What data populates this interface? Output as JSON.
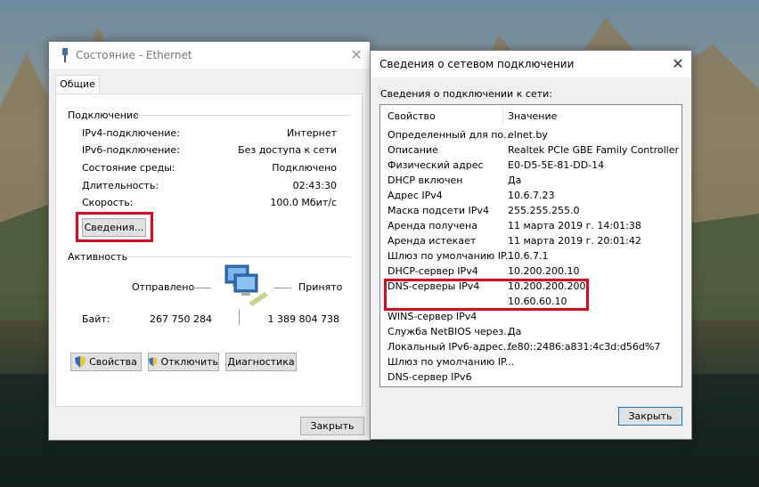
{
  "win1": {
    "title": "Состояние - Ethernet",
    "tab": "Общие",
    "connection": {
      "heading": "Подключение",
      "rows": [
        {
          "label": "IPv4-подключение:",
          "value": "Интернет"
        },
        {
          "label": "IPv6-подключение:",
          "value": "Без доступа к сети"
        },
        {
          "label": "Состояние среды:",
          "value": "Подключено"
        },
        {
          "label": "Длительность:",
          "value": "02:43:30"
        },
        {
          "label": "Скорость:",
          "value": "100.0 Мбит/с"
        }
      ]
    },
    "details_button": "Сведения...",
    "activity": {
      "heading": "Активность",
      "sent_label": "Отправлено",
      "received_label": "Принято",
      "bytes_label": "Байт:",
      "sent_bytes": "267 750 284",
      "received_bytes": "1 389 804 738"
    },
    "buttons": {
      "properties": "Свойства",
      "disable": "Отключить",
      "diagnose": "Диагностика",
      "close": "Закрыть"
    }
  },
  "win2": {
    "title": "Сведения о сетевом подключении",
    "subtitle": "Сведения о подключении к сети:",
    "columns": {
      "property": "Свойство",
      "value": "Значение"
    },
    "rows": [
      {
        "p": "Определенный для по...",
        "v": "elnet.by"
      },
      {
        "p": "Описание",
        "v": "Realtek PCIe GBE Family Controller"
      },
      {
        "p": "Физический адрес",
        "v": "E0-D5-5E-81-DD-14"
      },
      {
        "p": "DHCP включен",
        "v": "Да"
      },
      {
        "p": "Адрес IPv4",
        "v": "10.6.7.23"
      },
      {
        "p": "Маска подсети IPv4",
        "v": "255.255.255.0"
      },
      {
        "p": "Аренда получена",
        "v": "11 марта 2019 г. 14:01:38"
      },
      {
        "p": "Аренда истекает",
        "v": "11 марта 2019 г. 20:01:42"
      },
      {
        "p": "Шлюз по умолчанию IP...",
        "v": "10.6.7.1"
      },
      {
        "p": "DHCP-сервер IPv4",
        "v": "10.200.200.10"
      },
      {
        "p": "DNS-серверы IPv4",
        "v": "10.200.200.200"
      },
      {
        "p": "",
        "v": "10.60.60.10"
      },
      {
        "p": "WINS-сервер IPv4",
        "v": ""
      },
      {
        "p": "Служба NetBIOS через...",
        "v": "Да"
      },
      {
        "p": "Локальный IPv6-адрес...",
        "v": "fe80::2486:a831:4c3d:d56d%7"
      },
      {
        "p": "Шлюз по умолчанию IP...",
        "v": ""
      },
      {
        "p": "DNS-сервер IPv6",
        "v": ""
      }
    ],
    "close_button": "Закрыть"
  },
  "colors": {
    "highlight": "#e8001c",
    "accent": "#0078d7"
  }
}
